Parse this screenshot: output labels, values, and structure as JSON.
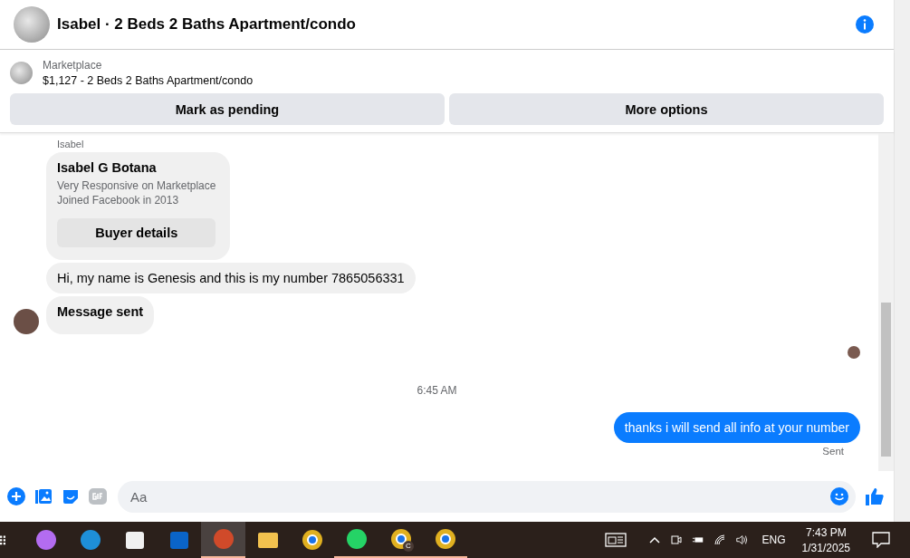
{
  "header": {
    "title": "Isabel · 2 Beds 2 Baths Apartment/condo"
  },
  "listing": {
    "source": "Marketplace",
    "title": "$1,127 - 2 Beds 2 Baths Apartment/condo"
  },
  "actions": [
    "Mark as pending",
    "More options"
  ],
  "thread": [
    {
      "kind": "sender",
      "text": "Isabel"
    },
    {
      "kind": "card",
      "name": "Isabel G Botana",
      "lines": [
        "Very Responsive on Marketplace",
        "Joined Facebook in 2013"
      ],
      "button": "Buyer details"
    },
    {
      "kind": "incoming",
      "text": "Hi, my name is Genesis and this is my number 7865056331",
      "avatar": false,
      "bold": false
    },
    {
      "kind": "incoming",
      "text": "Message sent",
      "avatar": true,
      "bold": true
    },
    {
      "kind": "seen"
    },
    {
      "kind": "time",
      "text": "6:45 AM"
    },
    {
      "kind": "outgoing",
      "text": "thanks i will send all info at your number"
    },
    {
      "kind": "status",
      "text": "Sent"
    }
  ],
  "composer": {
    "placeholder": "Aa"
  },
  "taskbar": {
    "apps": [
      {
        "kind": "copilot",
        "selected": false,
        "running": false
      },
      {
        "kind": "edge",
        "selected": false,
        "running": false
      },
      {
        "kind": "store",
        "selected": false,
        "running": false
      },
      {
        "kind": "outlook",
        "selected": false,
        "running": false
      },
      {
        "kind": "snip",
        "selected": true,
        "running": true
      },
      {
        "kind": "folder",
        "selected": false,
        "running": false
      },
      {
        "kind": "chrome",
        "selected": false,
        "running": false
      },
      {
        "kind": "whatsapp",
        "selected": false,
        "running": true
      },
      {
        "kind": "chrome-c",
        "selected": false,
        "running": true,
        "badge": "C"
      },
      {
        "kind": "chrome-p",
        "selected": false,
        "running": true
      }
    ],
    "language": "ENG",
    "time": "7:43 PM",
    "date": "1/31/2025"
  }
}
